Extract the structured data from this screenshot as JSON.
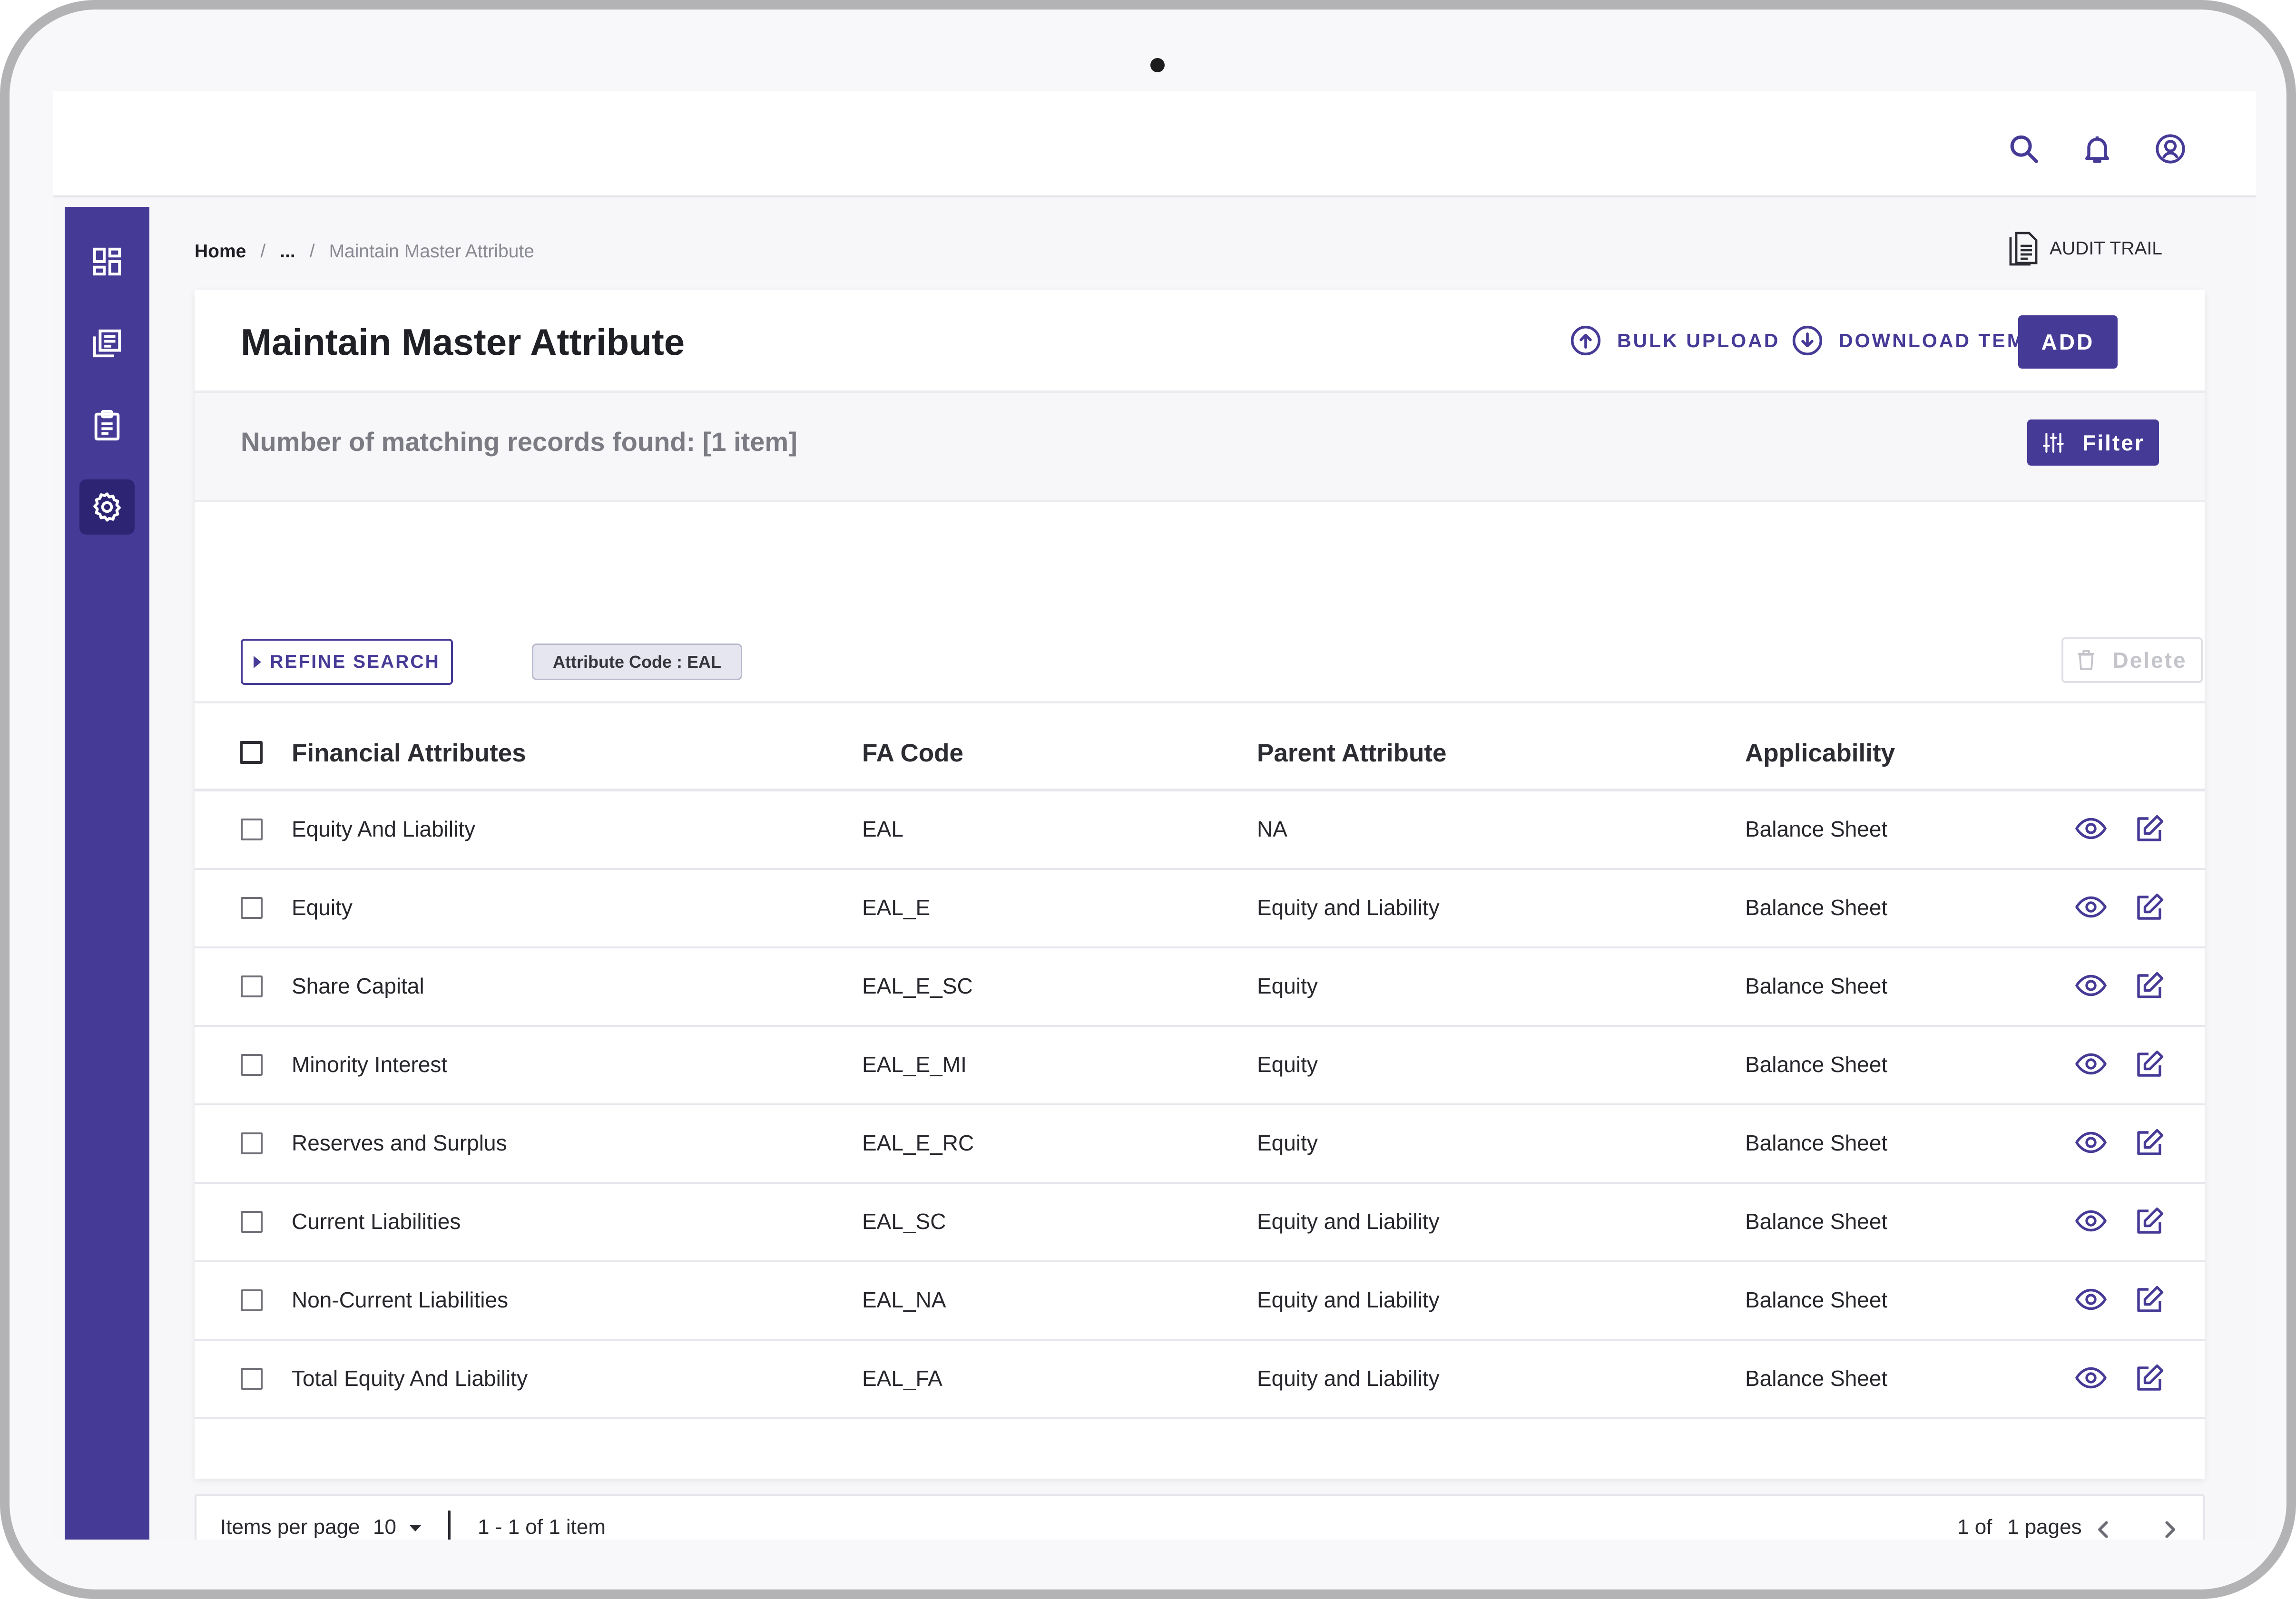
{
  "topbar": {
    "icons": [
      "search-icon",
      "bell-icon",
      "user-circle-icon"
    ]
  },
  "sidebar": {
    "items": [
      {
        "icon": "dashboard-icon",
        "active": false
      },
      {
        "icon": "library-icon",
        "active": false
      },
      {
        "icon": "clipboard-icon",
        "active": false
      },
      {
        "icon": "settings-icon",
        "active": true
      }
    ]
  },
  "breadcrumb": {
    "home": "Home",
    "ellipsis": "...",
    "current": "Maintain Master Attribute"
  },
  "audit_trail": "AUDIT TRAIL",
  "page": {
    "title": "Maintain Master Attribute",
    "bulk_upload": "BULK UPLOAD",
    "download_template": "DOWNLOAD TEMPLATE",
    "add": "ADD"
  },
  "records": {
    "text": "Number of matching records found: [1 item]",
    "filter": "Filter"
  },
  "toolbar": {
    "refine_search": "REFINE SEARCH",
    "chip": "Attribute Code : EAL",
    "delete": "Delete"
  },
  "table": {
    "headers": [
      "Financial Attributes",
      "FA Code",
      "Parent Attribute",
      "Applicability"
    ],
    "rows": [
      {
        "name": "Equity And Liability",
        "code": "EAL",
        "parent": "NA",
        "applicability": "Balance Sheet"
      },
      {
        "name": "Equity",
        "code": "EAL_E",
        "parent": "Equity and Liability",
        "applicability": "Balance Sheet"
      },
      {
        "name": "Share Capital",
        "code": "EAL_E_SC",
        "parent": "Equity",
        "applicability": "Balance Sheet"
      },
      {
        "name": "Minority Interest",
        "code": "EAL_E_MI",
        "parent": "Equity",
        "applicability": "Balance Sheet"
      },
      {
        "name": "Reserves and Surplus",
        "code": "EAL_E_RC",
        "parent": "Equity",
        "applicability": "Balance Sheet"
      },
      {
        "name": "Current Liabilities",
        "code": "EAL_SC",
        "parent": "Equity and Liability",
        "applicability": "Balance Sheet"
      },
      {
        "name": "Non-Current Liabilities",
        "code": "EAL_NA",
        "parent": "Equity and Liability",
        "applicability": "Balance Sheet"
      },
      {
        "name": "Total Equity And Liability",
        "code": "EAL_FA",
        "parent": "Equity and Liability",
        "applicability": "Balance Sheet"
      }
    ]
  },
  "pagination": {
    "items_per_page_label": "Items per page",
    "items_per_page_value": "10",
    "range": "1 - 1 of 1 item",
    "page_of": "1 of",
    "pages": "1 pages"
  },
  "colors": {
    "accent": "#463a97",
    "sidebar_active": "#2d2573"
  }
}
